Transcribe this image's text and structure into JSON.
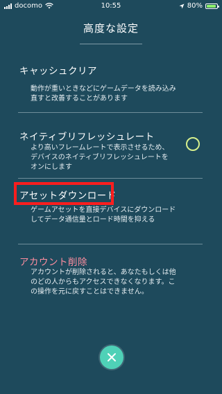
{
  "status_bar": {
    "carrier": "docomo",
    "time": "10:55",
    "battery": "80%",
    "battery_level": 0.8
  },
  "page": {
    "title": "高度な設定"
  },
  "sections": [
    {
      "title": "キャッシュクリア",
      "desc_lines": [
        "動作が重いときなどにゲームデータを読み込み",
        "直すと改善することがあります"
      ]
    },
    {
      "title": "ネイティブリフレッシュレート",
      "desc_lines": [
        "より高いフレームレートで表示させるため、",
        "デバイスのネイティブリフレッシュレートを",
        "オンにします"
      ],
      "toggle_state": "off"
    },
    {
      "title": "アセットダウンロード",
      "desc_lines": [
        "ゲームアセットを直接デバイスにダウンロード",
        "してデータ通信量とロード時間を抑える"
      ],
      "highlighted": true
    },
    {
      "title": "アカウント削除",
      "desc_lines": [
        "アカウントが削除されると、あなたもしくは他",
        "のどの人からもアクセスできなくなります。こ",
        "の操作を元に戻すことはできません。"
      ],
      "color": "#ff8ea0"
    }
  ],
  "close_button": {
    "icon": "close-icon"
  },
  "colors": {
    "background": "#1e4a5c",
    "toggle": "#d7f08d",
    "highlight": "#ff1e1e",
    "close_button": "#4fd1b7"
  }
}
